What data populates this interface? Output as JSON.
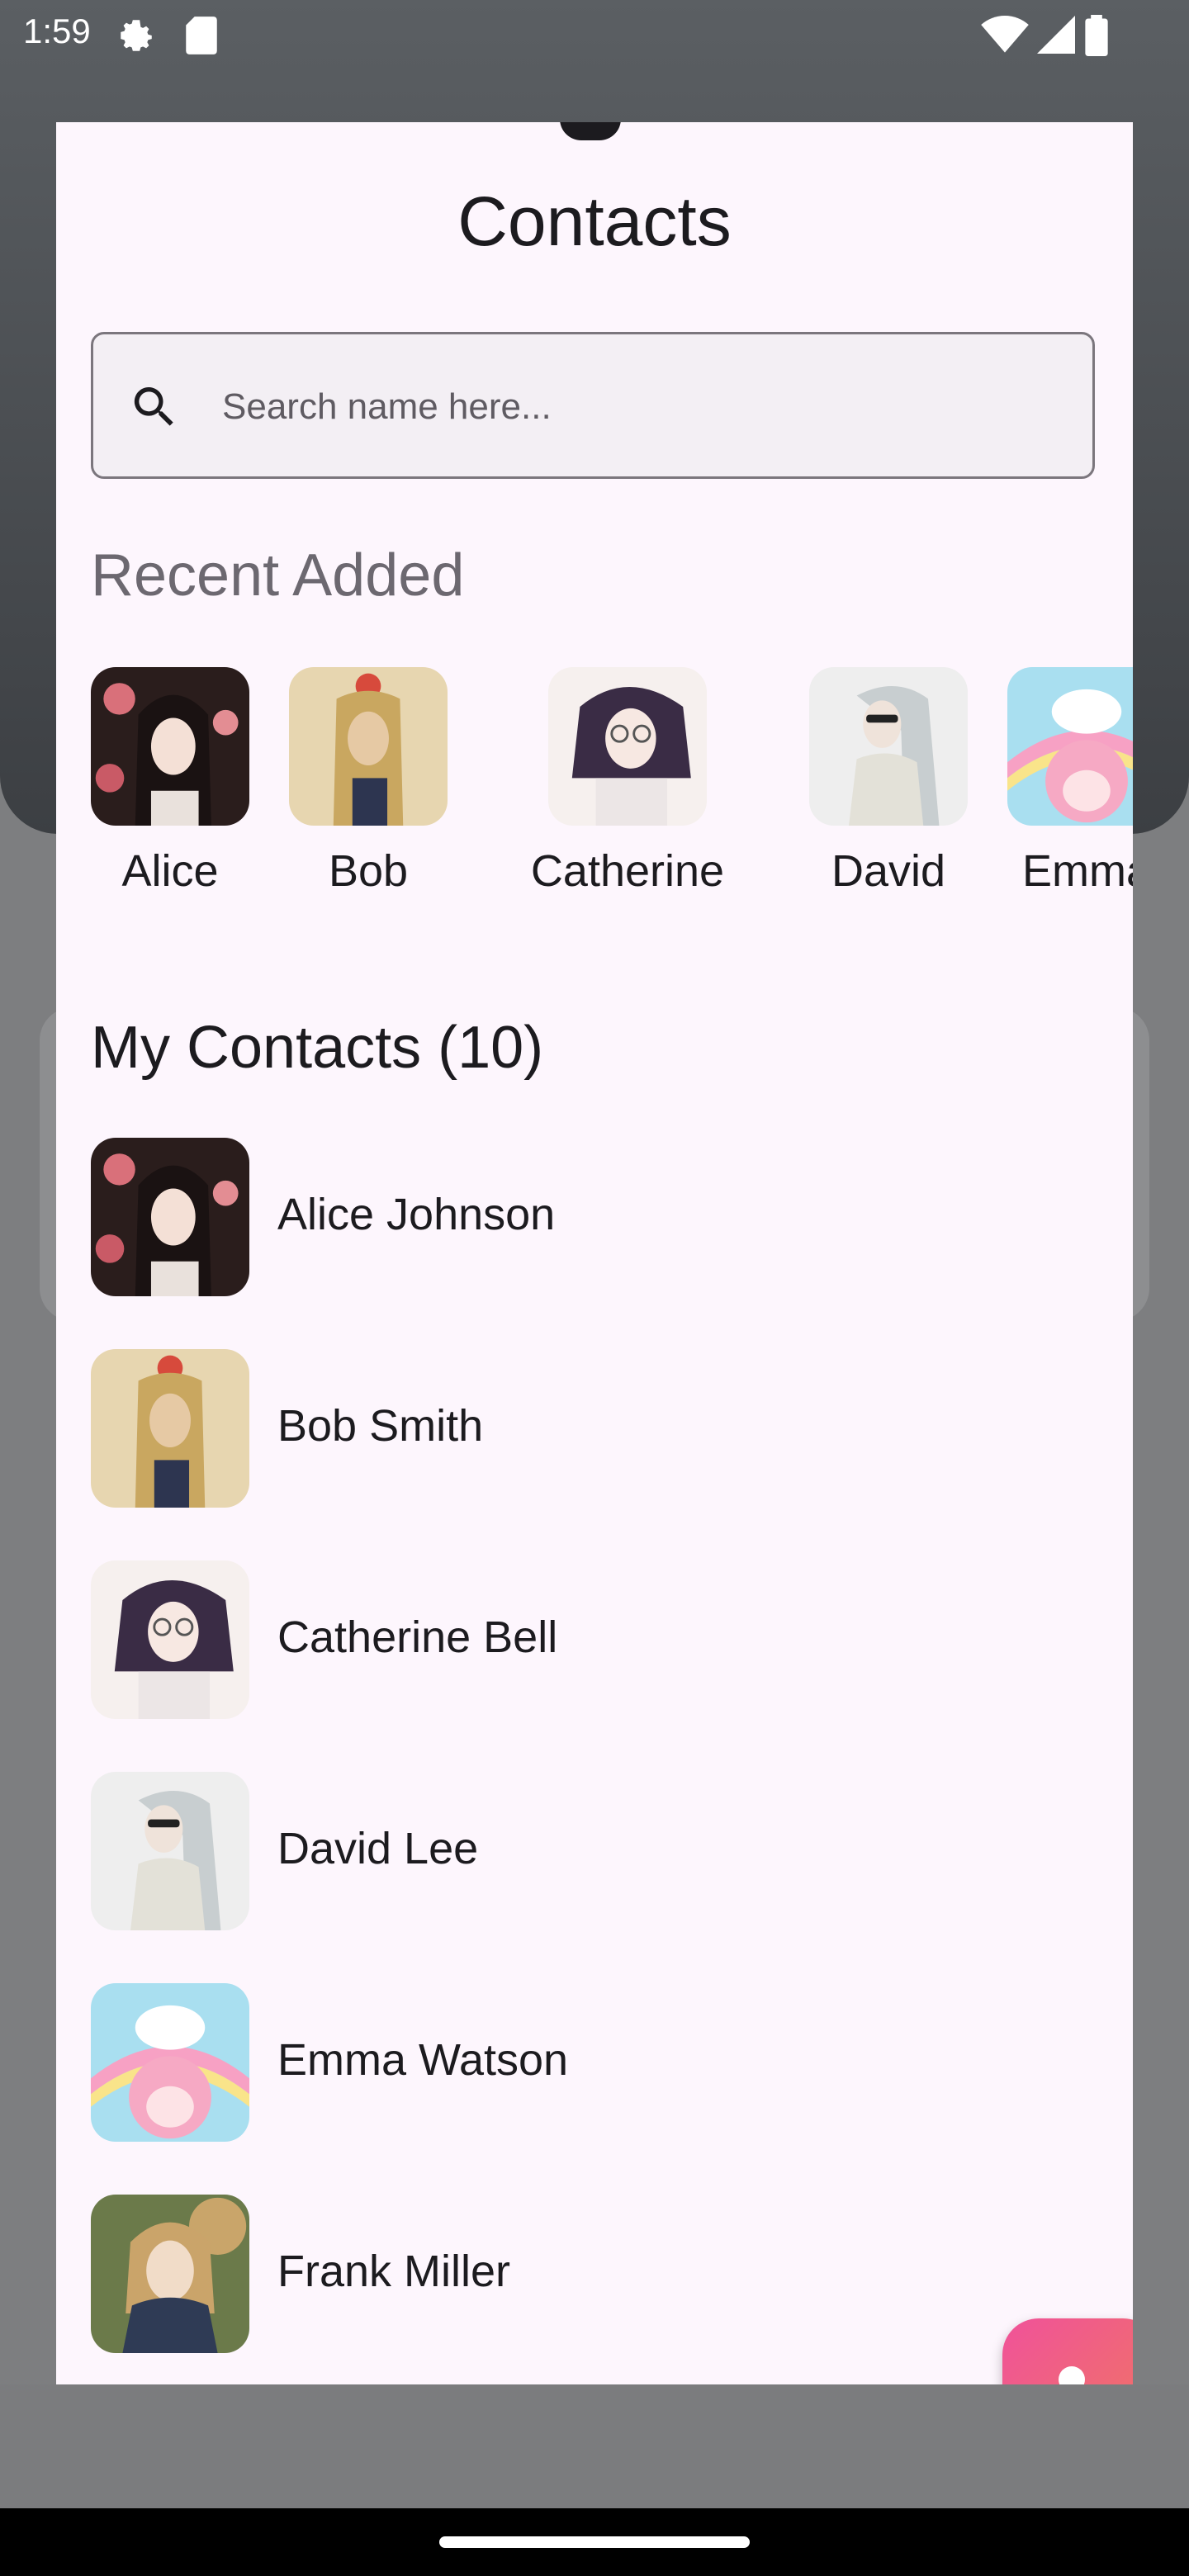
{
  "status_bar": {
    "time": "1:59",
    "icons": [
      "settings-icon",
      "sd-card-icon",
      "wifi-icon",
      "signal-icon",
      "battery-icon"
    ]
  },
  "sheet": {
    "title": "Contacts",
    "search": {
      "placeholder": "Search name here...",
      "value": ""
    },
    "recent_section_title": "Recent Added",
    "recent": [
      {
        "name": "Alice",
        "avatar": "alice"
      },
      {
        "name": "Bob",
        "avatar": "bob"
      },
      {
        "name": "Catherine",
        "avatar": "catherine"
      },
      {
        "name": "David",
        "avatar": "david"
      },
      {
        "name": "Emma",
        "avatar": "emma"
      }
    ],
    "contacts_section_title": "My Contacts (10)",
    "contacts": [
      {
        "name": "Alice Johnson",
        "avatar": "alice"
      },
      {
        "name": "Bob Smith",
        "avatar": "bob"
      },
      {
        "name": "Catherine Bell",
        "avatar": "catherine"
      },
      {
        "name": "David Lee",
        "avatar": "david"
      },
      {
        "name": "Emma Watson",
        "avatar": "emma"
      },
      {
        "name": "Frank Miller",
        "avatar": "frank"
      }
    ],
    "fab_icon": "add-person-icon"
  },
  "colors": {
    "sheet_background": "#fdf6fd",
    "fab_gradient_start": "#f0529a",
    "fab_gradient_end": "#f07a5a",
    "scrim": "#7d7e80"
  }
}
